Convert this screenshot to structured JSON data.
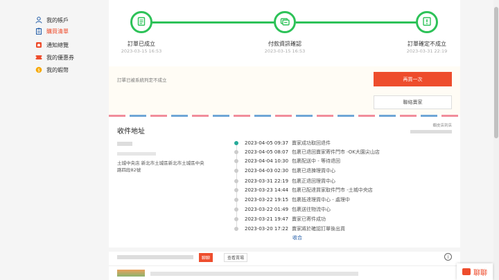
{
  "sidebar": {
    "items": [
      {
        "label": "我的帳戶",
        "icon": "user-icon",
        "color": "#1f5aa6"
      },
      {
        "label": "購買清單",
        "icon": "clipboard-icon",
        "color": "#1f5aa6"
      },
      {
        "label": "通知總覽",
        "icon": "bell-icon",
        "color": "#ee4d2d"
      },
      {
        "label": "我的優惠券",
        "icon": "coupon-icon",
        "color": "#ee4d2d"
      },
      {
        "label": "我的蝦幣",
        "icon": "coin-icon",
        "color": "#f6a700"
      }
    ]
  },
  "stepper": {
    "steps": [
      {
        "label": "訂單已成立",
        "time": "2023-03-15 16:53",
        "icon": "receipt-icon"
      },
      {
        "label": "付款資訊確認",
        "time": "2023-03-15 16:53",
        "icon": "payment-icon"
      },
      {
        "label": "訂單確定不成立",
        "time": "2023-03-31 22:19",
        "icon": "alert-icon"
      }
    ],
    "accent": "#2dc258"
  },
  "notice": {
    "text": "訂單已被系統判定不成立",
    "rebuy_label": "再買一次",
    "contact_label": "聯絡賣家"
  },
  "address": {
    "title": "收件地址",
    "corner": "蝦皮店到店",
    "line": "土城中央店 新北市土城區新北市土城區中央路四段82號"
  },
  "timeline": [
    {
      "time": "2023-04-05 09:37",
      "desc": "賣家成功取回退件"
    },
    {
      "time": "2023-04-05 08:07",
      "desc": "包裹已退回賣家寄件門市 -OK大園尖山店"
    },
    {
      "time": "2023-04-04 10:30",
      "desc": "包裹配送中 - 等待退回"
    },
    {
      "time": "2023-04-03 02:30",
      "desc": "包裹已退揀理貨中心"
    },
    {
      "time": "2023-03-31 22:19",
      "desc": "包裹正退回理貨中心"
    },
    {
      "time": "2023-03-23 14:44",
      "desc": "包裹已配達買家取件門市 -土城中央店"
    },
    {
      "time": "2023-03-22 19:15",
      "desc": "包裹抵達理貨中心 - 處理中"
    },
    {
      "time": "2023-03-22 01:49",
      "desc": "包裹送往物流中心"
    },
    {
      "time": "2023-03-21 19:47",
      "desc": "賣家已寄件成功"
    },
    {
      "time": "2023-03-20 17:22",
      "desc": "賣家將於確認訂單後出貨"
    }
  ],
  "collapse_label": "收合",
  "shop": {
    "chat_label": "聊聊",
    "view_label": "查看賣場"
  },
  "chat_float": {
    "label": "聊聊"
  }
}
